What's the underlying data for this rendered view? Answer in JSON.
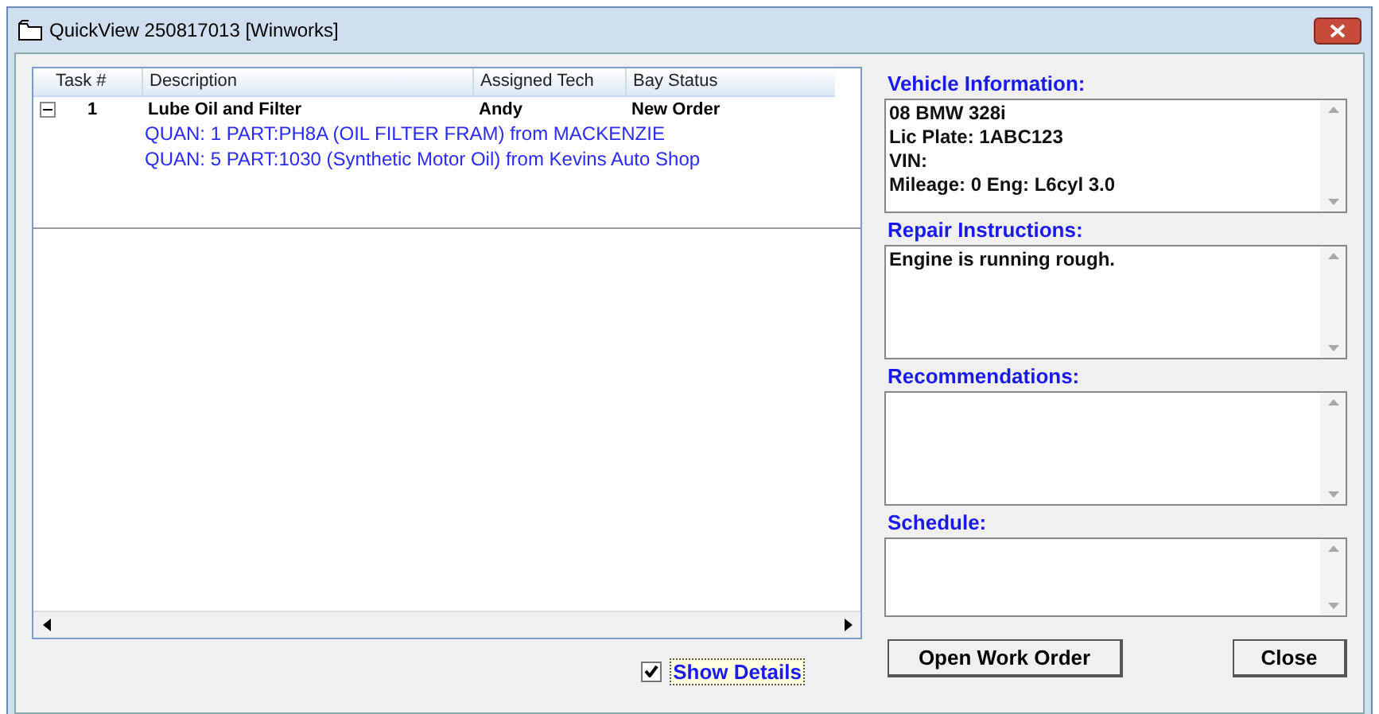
{
  "window": {
    "title": "QuickView  250817013 [Winworks]"
  },
  "table": {
    "columns": [
      "Task #",
      "Description",
      "Assigned Tech",
      "Bay Status"
    ],
    "rows": [
      {
        "task": "1",
        "description": "Lube Oil and Filter",
        "tech": "Andy",
        "status": "New Order",
        "expanded": true,
        "details": [
          "QUAN: 1  PART:PH8A (OIL FILTER FRAM) from MACKENZIE",
          "QUAN: 5  PART:1030 (Synthetic Motor Oil) from Kevins Auto Shop"
        ]
      }
    ]
  },
  "show_details": {
    "label": "Show Details",
    "checked": true
  },
  "sections": [
    {
      "label": "Vehicle Information:",
      "lines": [
        "08 BMW 328i",
        "Lic Plate: 1ABC123",
        "VIN:",
        "Mileage: 0 Eng: L6cyl 3.0"
      ]
    },
    {
      "label": "Repair Instructions:",
      "lines": [
        "Engine is running rough."
      ]
    },
    {
      "label": "Recommendations:"
    },
    {
      "label": "Schedule:"
    }
  ],
  "buttons": [
    "Open Work Order",
    "Close"
  ]
}
